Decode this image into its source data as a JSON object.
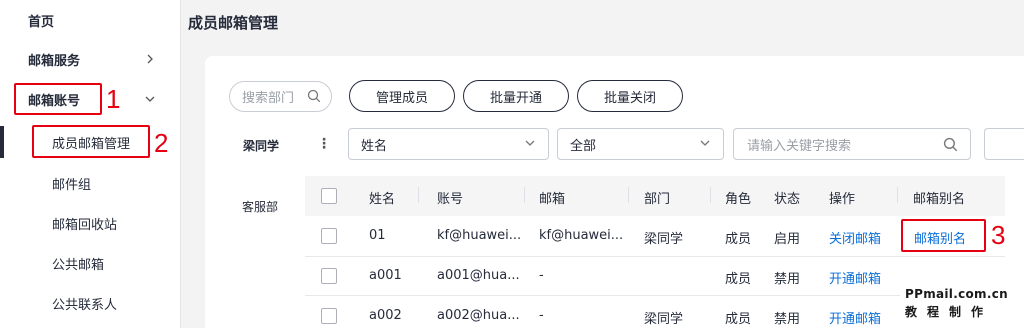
{
  "sidebar": {
    "home": "首页",
    "mail_service": "邮箱服务",
    "mail_account": "邮箱账号",
    "sub_items": [
      "成员邮箱管理",
      "邮件组",
      "邮箱回收站",
      "公共邮箱",
      "公共联系人"
    ]
  },
  "annotations": [
    "1",
    "2",
    "3"
  ],
  "page_title": "成员邮箱管理",
  "toolbar": {
    "search_placeholder": "搜索部门",
    "manage_members": "管理成员",
    "batch_open": "批量开通",
    "batch_close": "批量关闭"
  },
  "filter": {
    "dept_name": "梁同学",
    "kebab": "⋮",
    "field_select": "姓名",
    "status_select": "全部",
    "keyword_placeholder": "请输入关键字搜索"
  },
  "left_dept": "客服部",
  "table": {
    "columns": [
      "姓名",
      "账号",
      "邮箱",
      "部门",
      "角色",
      "状态",
      "操作",
      "邮箱别名"
    ],
    "rows": [
      {
        "name": "01",
        "account": "kf@huawei...",
        "email": "kf@huawei...",
        "dept": "梁同学",
        "role": "成员",
        "status": "启用",
        "action": "关闭邮箱",
        "alias": "邮箱别名"
      },
      {
        "name": "a001",
        "account": "a001@hua...",
        "email": "-",
        "dept": "",
        "role": "成员",
        "status": "禁用",
        "action": "开通邮箱",
        "alias": ""
      },
      {
        "name": "a002",
        "account": "a002@hua...",
        "email": "-",
        "dept": "梁同学",
        "role": "成员",
        "status": "禁用",
        "action": "开通邮箱",
        "alias": ""
      }
    ]
  },
  "watermark": {
    "line1": "PPmail.com.cn",
    "line2": "教程制作"
  },
  "colors": {
    "annotation_red": "#e60012",
    "link_blue": "#0b6fd9",
    "text": "#252b3a"
  }
}
